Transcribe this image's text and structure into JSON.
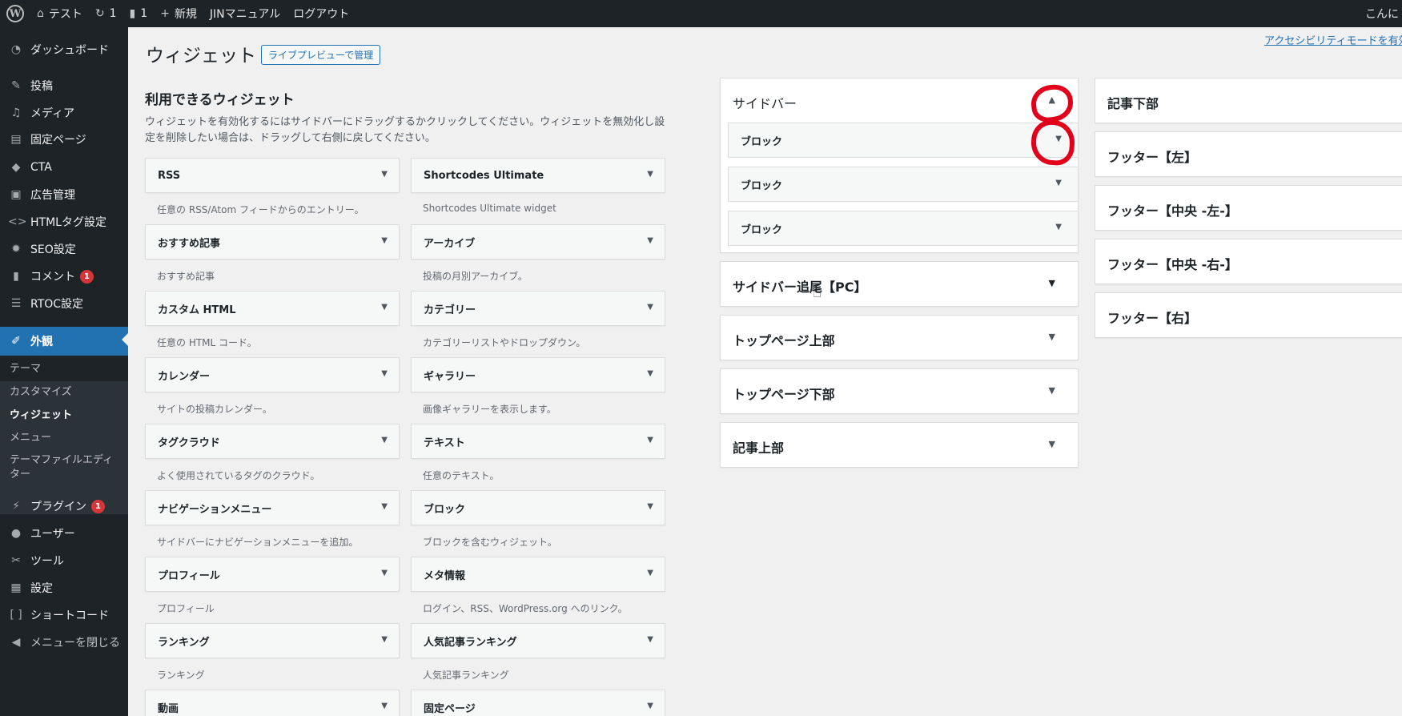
{
  "admin_bar": {
    "site_name": "テスト",
    "updates_count": "1",
    "comments_count": "1",
    "new_label": "新規",
    "manual_label": "JINマニュアル",
    "logout_label": "ログアウト",
    "howdy": "こんに"
  },
  "sidebar": {
    "items": [
      {
        "label": "ダッシュボード",
        "icon": "dashboard-icon"
      },
      {
        "label": "投稿",
        "icon": "pin-icon"
      },
      {
        "label": "メディア",
        "icon": "media-icon"
      },
      {
        "label": "固定ページ",
        "icon": "page-icon"
      },
      {
        "label": "CTA",
        "icon": "tag-icon"
      },
      {
        "label": "広告管理",
        "icon": "ad-icon"
      },
      {
        "label": "HTMLタグ設定",
        "icon": "code-icon"
      },
      {
        "label": "SEO設定",
        "icon": "gear-icon"
      },
      {
        "label": "コメント",
        "icon": "comment-icon",
        "badge": "1"
      },
      {
        "label": "RTOC設定",
        "icon": "list-icon"
      },
      {
        "label": "外観",
        "icon": "brush-icon"
      },
      {
        "label": "プラグイン",
        "icon": "plugin-icon",
        "badge": "1"
      },
      {
        "label": "ユーザー",
        "icon": "user-icon"
      },
      {
        "label": "ツール",
        "icon": "wrench-icon"
      },
      {
        "label": "設定",
        "icon": "settings-icon"
      },
      {
        "label": "ショートコード",
        "icon": "shortcode-icon"
      },
      {
        "label": "メニューを閉じる",
        "icon": "collapse-icon"
      }
    ],
    "submenu": [
      "テーマ",
      "カスタマイズ",
      "ウィジェット",
      "メニュー",
      "テーマファイルエディター"
    ]
  },
  "header": {
    "title": "ウィジェット",
    "live_preview_button": "ライブプレビューで管理",
    "accessibility_link": "アクセシビリティモードを有効"
  },
  "available": {
    "title": "利用できるウィジェット",
    "description": "ウィジェットを有効化するにはサイドバーにドラッグするかクリックしてください。ウィジェットを無効化し設定を削除したい場合は、ドラッグして右側に戻してください。",
    "widgets": [
      {
        "name": "RSS",
        "desc": "任意の RSS/Atom フィードからのエントリー。"
      },
      {
        "name": "Shortcodes Ultimate",
        "desc": "Shortcodes Ultimate widget"
      },
      {
        "name": "おすすめ記事",
        "desc": "おすすめ記事"
      },
      {
        "name": "アーカイブ",
        "desc": "投稿の月別アーカイブ。"
      },
      {
        "name": "カスタム HTML",
        "desc": "任意の HTML コード。"
      },
      {
        "name": "カテゴリー",
        "desc": "カテゴリーリストやドロップダウン。"
      },
      {
        "name": "カレンダー",
        "desc": "サイトの投稿カレンダー。"
      },
      {
        "name": "ギャラリー",
        "desc": "画像ギャラリーを表示します。"
      },
      {
        "name": "タグクラウド",
        "desc": "よく使用されているタグのクラウド。"
      },
      {
        "name": "テキスト",
        "desc": "任意のテキスト。"
      },
      {
        "name": "ナビゲーションメニュー",
        "desc": "サイドバーにナビゲーションメニューを追加。"
      },
      {
        "name": "ブロック",
        "desc": "ブロックを含むウィジェット。"
      },
      {
        "name": "プロフィール",
        "desc": "プロフィール"
      },
      {
        "name": "メタ情報",
        "desc": "ログイン、RSS、WordPress.org へのリンク。"
      },
      {
        "name": "ランキング",
        "desc": "ランキング"
      },
      {
        "name": "人気記事ランキング",
        "desc": "人気記事ランキング"
      },
      {
        "name": "動画",
        "desc": ""
      },
      {
        "name": "固定ページ",
        "desc": ""
      }
    ]
  },
  "areas": {
    "sidebar": {
      "title": "サイドバー",
      "blocks": [
        "ブロック",
        "ブロック",
        "ブロック"
      ]
    },
    "middle": [
      "サイドバー追尾【PC】",
      "トップページ上部",
      "トップページ下部",
      "記事上部"
    ],
    "right": [
      "記事下部",
      "フッター【左】",
      "フッター【中央 -左-】",
      "フッター【中央 -右-】",
      "フッター【右】"
    ]
  },
  "colors": {
    "admin_bar_bg": "#1d2327",
    "accent": "#2271b1",
    "annotation": "#e2001a",
    "badge": "#d63638"
  }
}
